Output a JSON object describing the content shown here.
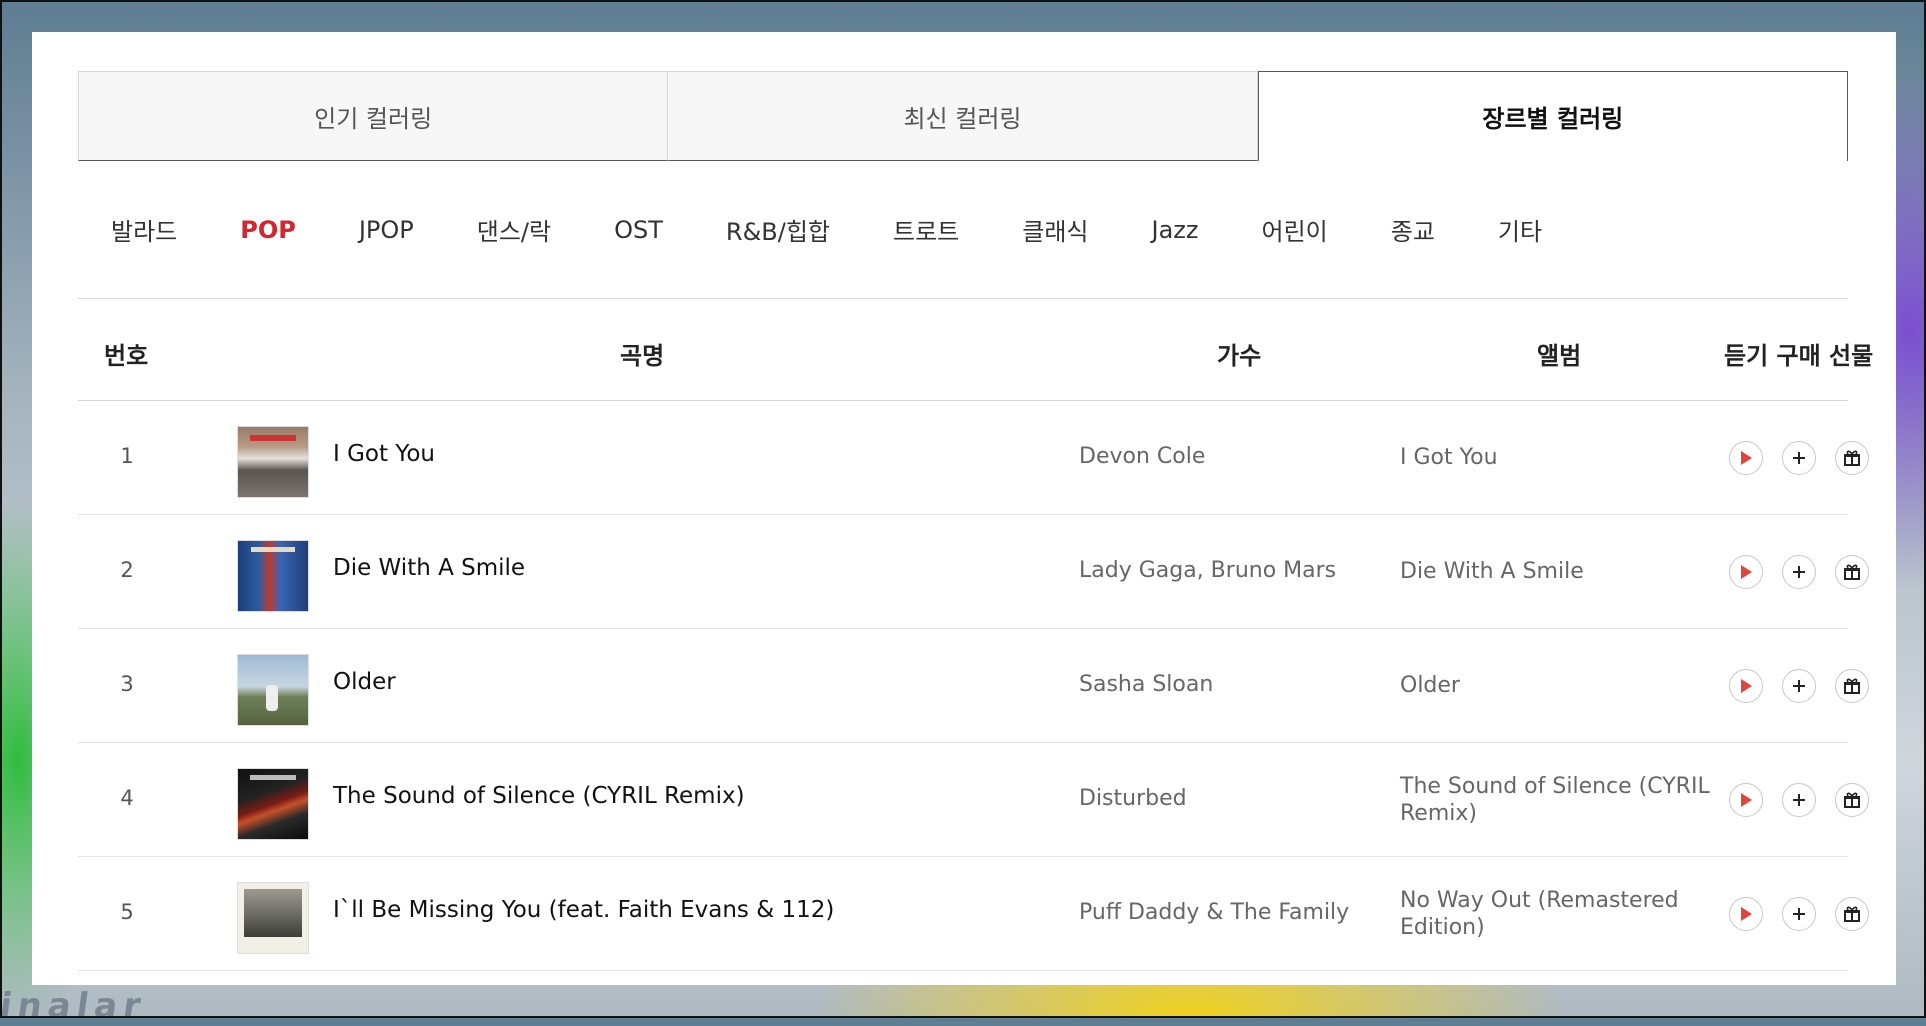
{
  "tabs": [
    {
      "label": "인기 컬러링"
    },
    {
      "label": "최신 컬러링"
    },
    {
      "label": "장르별 컬러링"
    }
  ],
  "active_tab": "장르별 컬러링",
  "genres": [
    "발라드",
    "POP",
    "JPOP",
    "댄스/락",
    "OST",
    "R&B/힙합",
    "트로트",
    "클래식",
    "Jazz",
    "어린이",
    "종교",
    "기타"
  ],
  "active_genre": "POP",
  "table": {
    "headers": {
      "num": "번호",
      "title": "곡명",
      "artist": "가수",
      "album": "앨범",
      "actions": "듣기 구매 선물"
    },
    "rows": [
      {
        "num": "1",
        "title": "I Got You",
        "artist": "Devon Cole",
        "album": "I Got You"
      },
      {
        "num": "2",
        "title": "Die With A Smile",
        "artist": "Lady Gaga, Bruno Mars",
        "album": "Die With A Smile"
      },
      {
        "num": "3",
        "title": "Older",
        "artist": "Sasha Sloan",
        "album": "Older"
      },
      {
        "num": "4",
        "title": "The Sound of Silence (CYRIL Remix)",
        "artist": "Disturbed",
        "album": "The Sound of Silence (CYRIL Remix)"
      },
      {
        "num": "5",
        "title": "I`ll Be Missing You (feat. Faith Evans & 112)",
        "artist": "Puff Daddy & The Family",
        "album": "No Way Out (Remastered Edition)"
      }
    ]
  },
  "icons": {
    "play": "play-icon",
    "purchase": "plus-icon",
    "gift": "gift-icon"
  },
  "colors": {
    "accent": "#d4262f",
    "play": "#e0453d",
    "text": "#111111",
    "muted": "#666666"
  },
  "background_text": "inalar"
}
